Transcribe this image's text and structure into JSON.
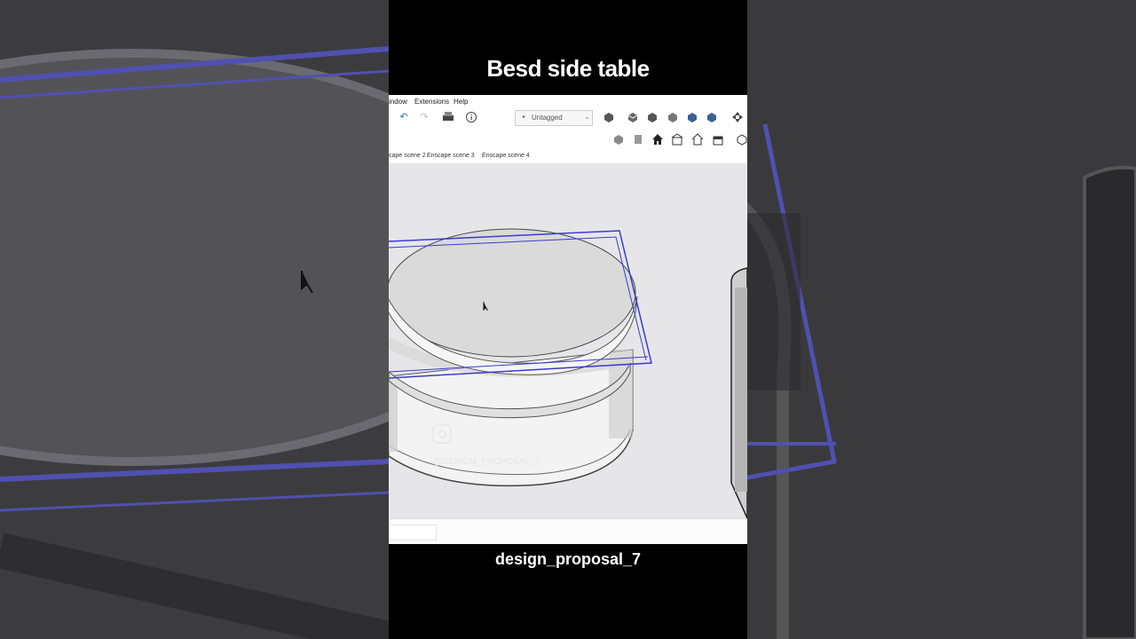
{
  "video": {
    "title": "Besd side table",
    "caption": "design_proposal_7"
  },
  "app": {
    "menu": [
      "indow",
      "Extensions",
      "Help"
    ],
    "tag_selector": {
      "value": "Untagged"
    },
    "scene_tabs": [
      "cape scene 2",
      "Enscape scene 3",
      "Enscape scene 4"
    ],
    "watermark": "@DESIGN_PROPOSAL_7",
    "icons": [
      "undo-icon",
      "redo-icon",
      "print-icon",
      "info-icon",
      "component-icon",
      "view-icon",
      "house-icon"
    ]
  }
}
